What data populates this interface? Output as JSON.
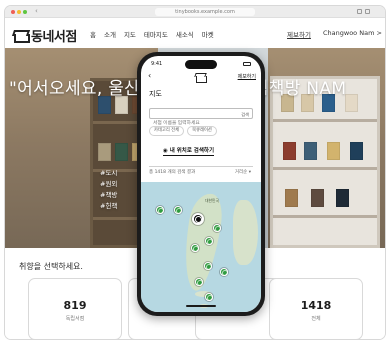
{
  "browser": {
    "url": "tinybooks.example.com"
  },
  "header": {
    "logo_text": "동네서점",
    "menu": [
      "홈",
      "소개",
      "지도",
      "테마지도",
      "새소식",
      "마켓"
    ],
    "report_link": "제보하기",
    "user": "Changwoo Nam >"
  },
  "hero": {
    "title": "\"어서오세요, 울산의 독립 서점 그림책방 NAM",
    "tags": [
      "#도시",
      "#원외",
      "#책방",
      "#헌책"
    ]
  },
  "preferences": {
    "title": "취향을 선택하세요.",
    "cards": [
      {
        "value": "819",
        "label": "독립서점"
      },
      {
        "value": "",
        "label": ""
      },
      {
        "value": "",
        "label": ""
      },
      {
        "value": "1418",
        "label": "전체"
      }
    ]
  },
  "phone": {
    "time": "9:41",
    "report_link": "제보하기",
    "screen_title": "지도",
    "search_placeholder": "서점 이름을 입력하세요",
    "search_button": "검색",
    "filters": [
      "카테고리 전체",
      "북큐레이션"
    ],
    "locate_label": "내 위치로 검색하기",
    "result_count": "총 1418 개의 검색 결과",
    "sort_label": "거리순",
    "map_label": "대한민국"
  }
}
